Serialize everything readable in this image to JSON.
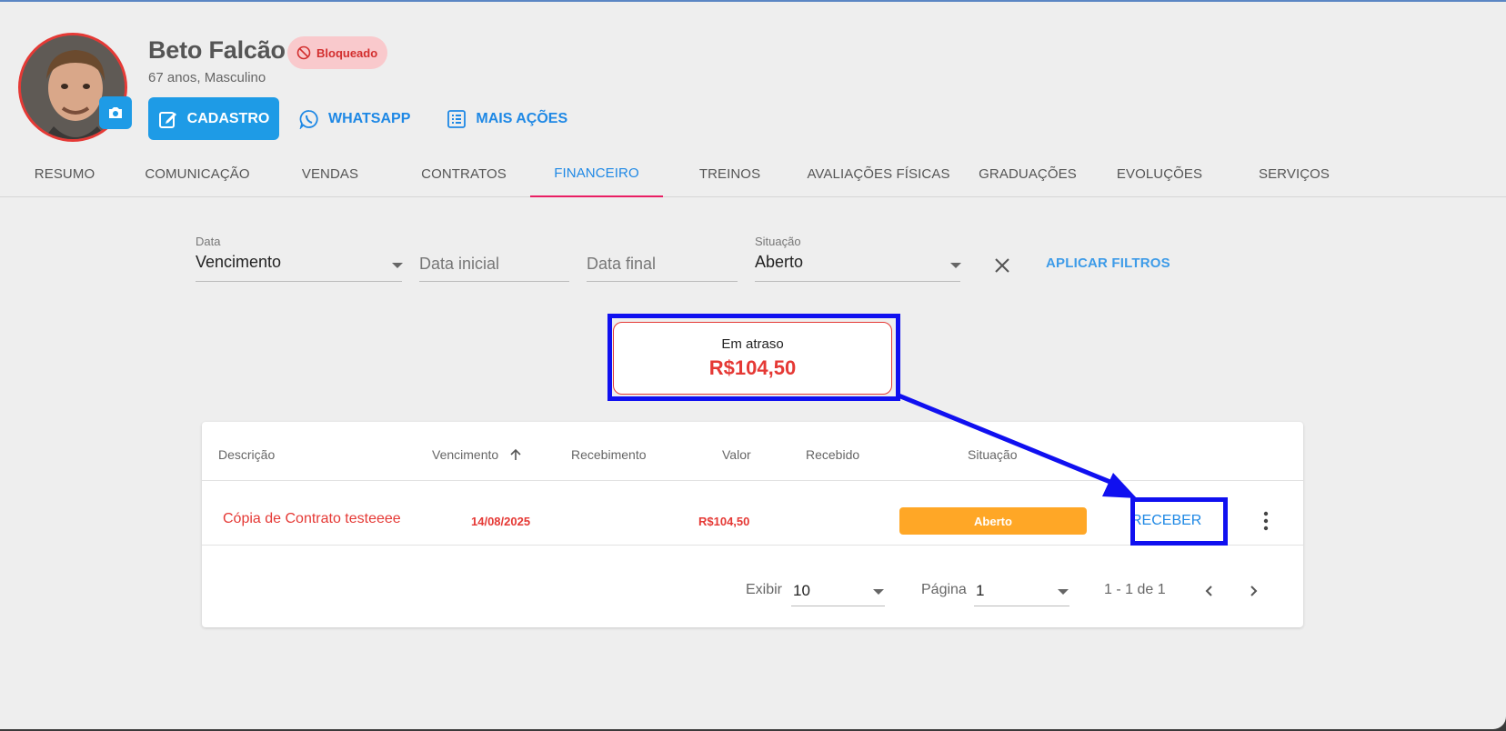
{
  "profile": {
    "name": "Beto Falcão",
    "status_badge": "Bloqueado",
    "subtitle": "67 anos, Masculino",
    "avatar_icon": "person-photo",
    "camera_icon": "camera-icon"
  },
  "actions": {
    "cadastro": "CADASTRO",
    "whatsapp": "WHATSAPP",
    "mais_acoes": "MAIS AÇÕES"
  },
  "tabs": [
    {
      "label": "RESUMO"
    },
    {
      "label": "COMUNICAÇÃO"
    },
    {
      "label": "VENDAS"
    },
    {
      "label": "CONTRATOS"
    },
    {
      "label": "FINANCEIRO",
      "active": true
    },
    {
      "label": "TREINOS"
    },
    {
      "label": "AVALIAÇÕES FÍSICAS"
    },
    {
      "label": "GRADUAÇÕES"
    },
    {
      "label": "EVOLUÇÕES"
    },
    {
      "label": "SERVIÇOS"
    }
  ],
  "filters": {
    "data_label": "Data",
    "data_value": "Vencimento",
    "data_inicial_placeholder": "Data inicial",
    "data_final_placeholder": "Data final",
    "situacao_label": "Situação",
    "situacao_value": "Aberto",
    "apply_label": "APLICAR FILTROS"
  },
  "summary": {
    "title": "Em atraso",
    "value": "R$104,50"
  },
  "table": {
    "headers": [
      "Descrição",
      "Vencimento",
      "Recebimento",
      "Valor",
      "Recebido",
      "Situação"
    ],
    "rows": [
      {
        "descricao": "Cópia de Contrato testeeee",
        "vencimento": "14/08/2025",
        "recebimento": "",
        "valor": "R$104,50",
        "recebido": "",
        "situacao": "Aberto",
        "action": "RECEBER"
      }
    ]
  },
  "pagination": {
    "exibir_label": "Exibir",
    "exibir_value": "10",
    "pagina_label": "Página",
    "pagina_value": "1",
    "range": "1 - 1 de 1"
  },
  "colors": {
    "primary": "#1e9be6",
    "danger": "#e53935",
    "warning": "#ffa726",
    "annotation": "#1010f0",
    "tab_indicator": "#e91e63"
  }
}
